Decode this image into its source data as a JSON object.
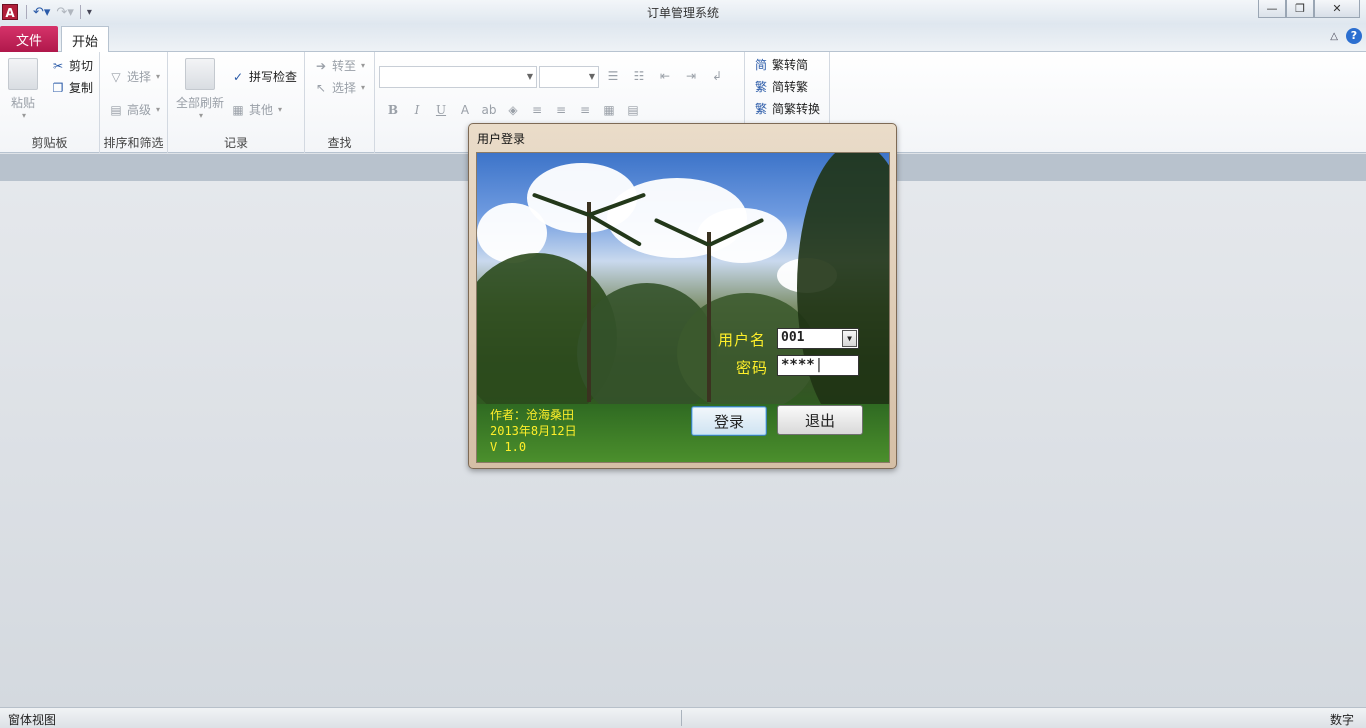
{
  "window": {
    "title": "订单管理系统",
    "app_icon_letter": "A",
    "qat": {
      "undo_icon": "undo-icon",
      "redo_icon": "redo-icon",
      "customize_icon": "customize-qat-icon"
    },
    "controls": {
      "minimize": "—",
      "restore": "❐",
      "close": "✕"
    }
  },
  "tabs": {
    "file": "文件",
    "home": "开始"
  },
  "ribbon": {
    "clipboard": {
      "label": "剪贴板",
      "paste": "粘贴",
      "cut": "剪切",
      "copy": "复制"
    },
    "sort_filter": {
      "label": "排序和筛选",
      "select": "选择",
      "advanced": "高级"
    },
    "records": {
      "label": "记录",
      "refresh_all": "全部刷新",
      "spell_check": "拼写检查",
      "other": "其他"
    },
    "find": {
      "label": "查找",
      "goto": "转至",
      "select": "选择"
    },
    "convert": {
      "trad_to_simp": "繁转简",
      "simp_to_trad": "简转繁",
      "convert_both": "简繁转换"
    }
  },
  "dialog": {
    "title": "用户登录",
    "username_label": "用户名",
    "username_value": "001",
    "password_label": "密码",
    "password_value": "****",
    "login_button": "登录",
    "exit_button": "退出",
    "author": "作者：沧海桑田",
    "date": "2013年8月12日",
    "version": "V 1.0"
  },
  "status": {
    "left": "窗体视图",
    "right": "数字"
  },
  "colors": {
    "file_tab": "#c61f58",
    "label_yellow": "#ffef2a",
    "dialog_frame": "#d5bfa6"
  }
}
